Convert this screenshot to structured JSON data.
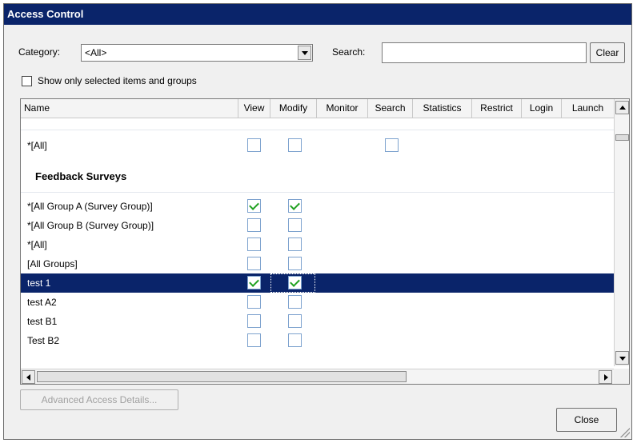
{
  "window": {
    "title": "Access Control"
  },
  "filters": {
    "category_label": "Category:",
    "category_value": "<All>",
    "search_label": "Search:",
    "search_value": "",
    "clear_label": "Clear",
    "show_selected_label": "Show only selected items and groups",
    "show_selected_checked": false
  },
  "grid": {
    "columns": [
      "Name",
      "View",
      "Modify",
      "Monitor",
      "Search",
      "Statistics",
      "Restrict",
      "Login",
      "Launch"
    ],
    "top_rows": [
      {
        "name": "*[All]",
        "view": false,
        "modify": false,
        "search": false
      }
    ],
    "group_name": "Feedback Surveys",
    "group_rows": [
      {
        "name": "*[All Group A (Survey Group)]",
        "view": true,
        "modify": true,
        "selected": false
      },
      {
        "name": "*[All Group B (Survey Group)]",
        "view": false,
        "modify": false,
        "selected": false
      },
      {
        "name": "*[All]",
        "view": false,
        "modify": false,
        "selected": false
      },
      {
        "name": "[All Groups]",
        "view": false,
        "modify": false,
        "selected": false
      },
      {
        "name": "test 1",
        "view": true,
        "modify": true,
        "selected": true
      },
      {
        "name": "test A2",
        "view": false,
        "modify": false,
        "selected": false
      },
      {
        "name": "test B1",
        "view": false,
        "modify": false,
        "selected": false
      },
      {
        "name": "Test B2",
        "view": false,
        "modify": false,
        "selected": false
      }
    ]
  },
  "footer": {
    "advanced_label": "Advanced Access Details...",
    "close_label": "Close"
  },
  "colors": {
    "titlebar": "#0a246a",
    "selection": "#0a246a",
    "check": "#21a121",
    "checkbox_border": "#7da2ce"
  }
}
